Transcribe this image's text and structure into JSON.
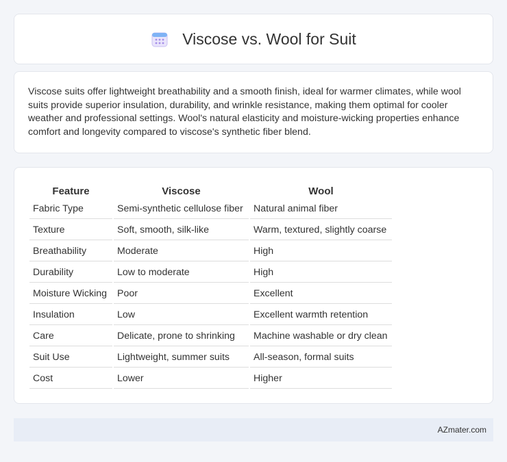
{
  "header": {
    "title": "Viscose vs. Wool for Suit",
    "icon": "calendar-icon"
  },
  "summary": {
    "text": "Viscose suits offer lightweight breathability and a smooth finish, ideal for warmer climates, while wool suits provide superior insulation, durability, and wrinkle resistance, making them optimal for cooler weather and professional settings. Wool's natural elasticity and moisture-wicking properties enhance comfort and longevity compared to viscose's synthetic fiber blend."
  },
  "table": {
    "headers": [
      "Feature",
      "Viscose",
      "Wool"
    ],
    "rows": [
      [
        "Fabric Type",
        "Semi-synthetic cellulose fiber",
        "Natural animal fiber"
      ],
      [
        "Texture",
        "Soft, smooth, silk-like",
        "Warm, textured, slightly coarse"
      ],
      [
        "Breathability",
        "Moderate",
        "High"
      ],
      [
        "Durability",
        "Low to moderate",
        "High"
      ],
      [
        "Moisture Wicking",
        "Poor",
        "Excellent"
      ],
      [
        "Insulation",
        "Low",
        "Excellent warmth retention"
      ],
      [
        "Care",
        "Delicate, prone to shrinking",
        "Machine washable or dry clean"
      ],
      [
        "Suit Use",
        "Lightweight, summer suits",
        "All-season, formal suits"
      ],
      [
        "Cost",
        "Lower",
        "Higher"
      ]
    ]
  },
  "footer": {
    "text": "AZmater.com"
  }
}
